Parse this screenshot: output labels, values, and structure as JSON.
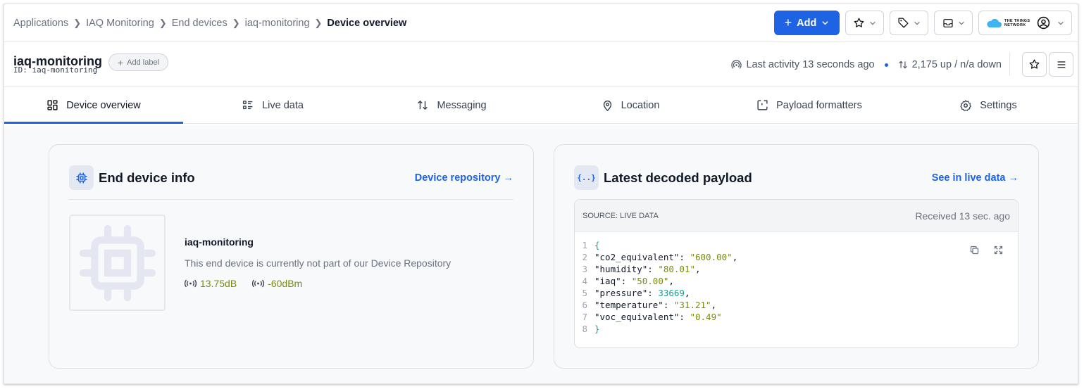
{
  "breadcrumb": [
    "Applications",
    "IAQ Monitoring",
    "End devices",
    "iaq-monitoring",
    "Device overview"
  ],
  "topbar": {
    "add_label": "Add",
    "ttn_line1": "THE THINGS",
    "ttn_line2": "NETWORK"
  },
  "device": {
    "name": "iaq-monitoring",
    "id": "ID: iaq-monitoring",
    "add_label": "Add label",
    "last_activity": "Last activity 13 seconds ago",
    "traffic": "2,175 up / n/a down"
  },
  "tabs": [
    {
      "label": "Device overview",
      "icon": "grid-icon",
      "active": true
    },
    {
      "label": "Live data",
      "icon": "list-icon"
    },
    {
      "label": "Messaging",
      "icon": "updown-arrows-icon"
    },
    {
      "label": "Location",
      "icon": "location-pin-icon"
    },
    {
      "label": "Payload formatters",
      "icon": "formatter-icon"
    },
    {
      "label": "Settings",
      "icon": "gear-icon"
    }
  ],
  "info_card": {
    "title": "End device info",
    "link": "Device repository →",
    "device_name": "iaq-monitoring",
    "description": "This end device is currently not part of our Device Repository",
    "snr": "13.75dB",
    "rssi": "-60dBm"
  },
  "payload_card": {
    "title": "Latest decoded payload",
    "link": "See in live data →",
    "source": "SOURCE: LIVE DATA",
    "received": "Received 13 sec. ago",
    "payload": {
      "co2_equivalent": "600.00",
      "humidity": "80.01",
      "iaq": "50.00",
      "pressure": 33669,
      "temperature": "31.21",
      "voc_equivalent": "0.49"
    }
  },
  "colors": {
    "accent": "#1d63e3",
    "string": "#7a8a0c",
    "number": "#1a9d8c"
  }
}
